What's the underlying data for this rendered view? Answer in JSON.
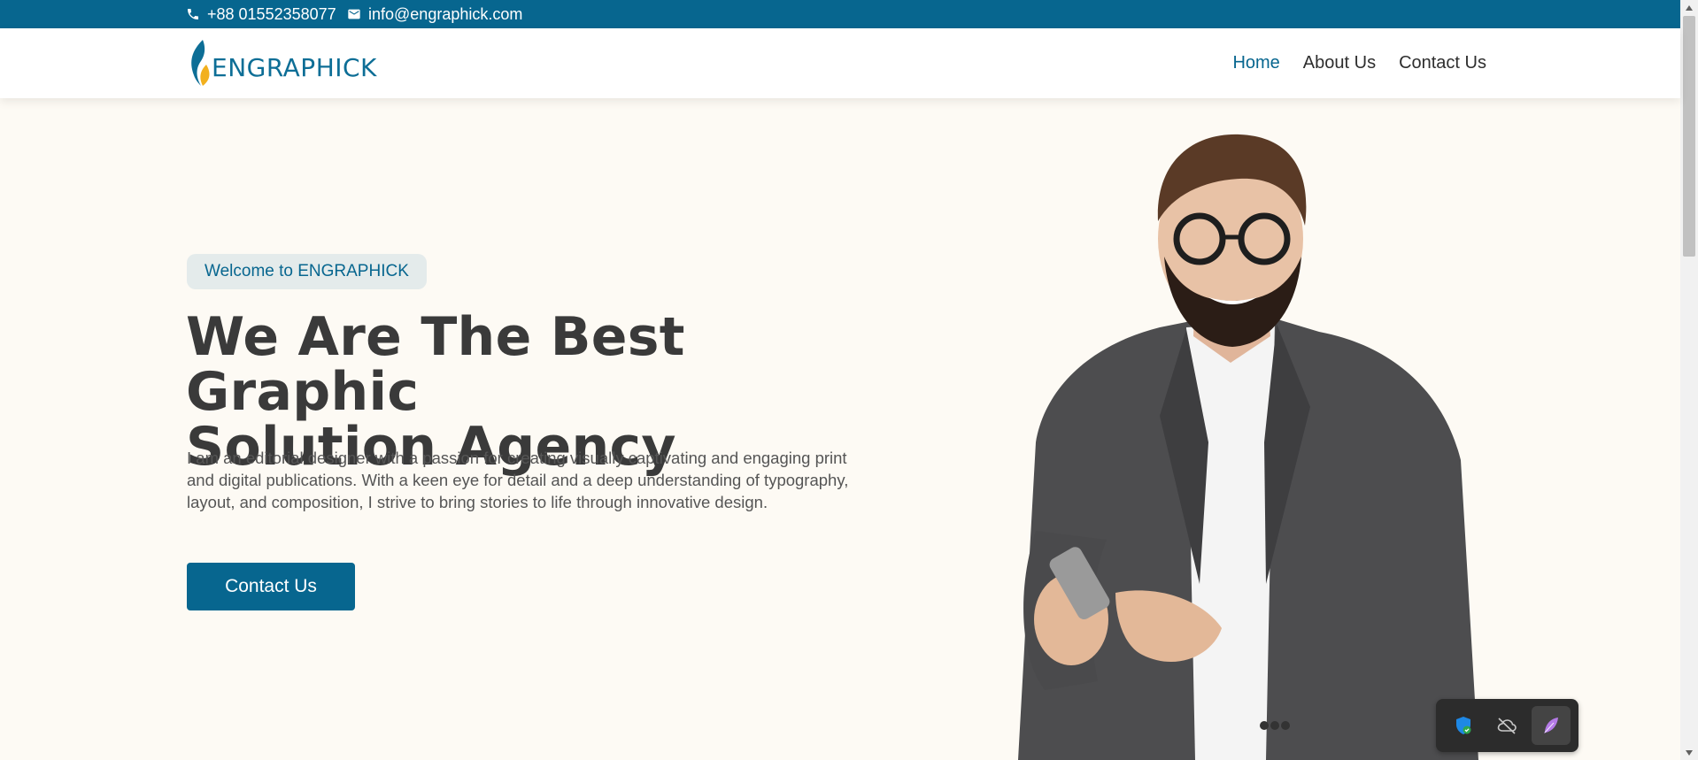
{
  "topbar": {
    "phone": "+88 01552358077",
    "email": "info@engraphick.com"
  },
  "header": {
    "logo_text": "ENGRAPHICK",
    "nav": [
      {
        "label": "Home",
        "active": true
      },
      {
        "label": "About Us",
        "active": false
      },
      {
        "label": "Contact Us",
        "active": false
      }
    ]
  },
  "hero": {
    "badge": "Welcome to ENGRAPHICK",
    "title_line1": "We Are The Best Graphic",
    "title_line2": "Solution Agency",
    "description": "I am an editorial designer with a passion for creating visually captivating and engaging print and digital publications. With a keen eye for detail and a deep understanding of typography, layout, and composition, I strive to bring stories to life through innovative design.",
    "cta_label": "Contact Us"
  },
  "colors": {
    "brand": "#07668f",
    "accent": "#f2b01e",
    "page_bg": "#fdfaf4",
    "heading": "#3a3a3a"
  },
  "tray": {
    "icons": [
      "shield-check-icon",
      "cloud-off-icon",
      "feather-icon"
    ]
  }
}
